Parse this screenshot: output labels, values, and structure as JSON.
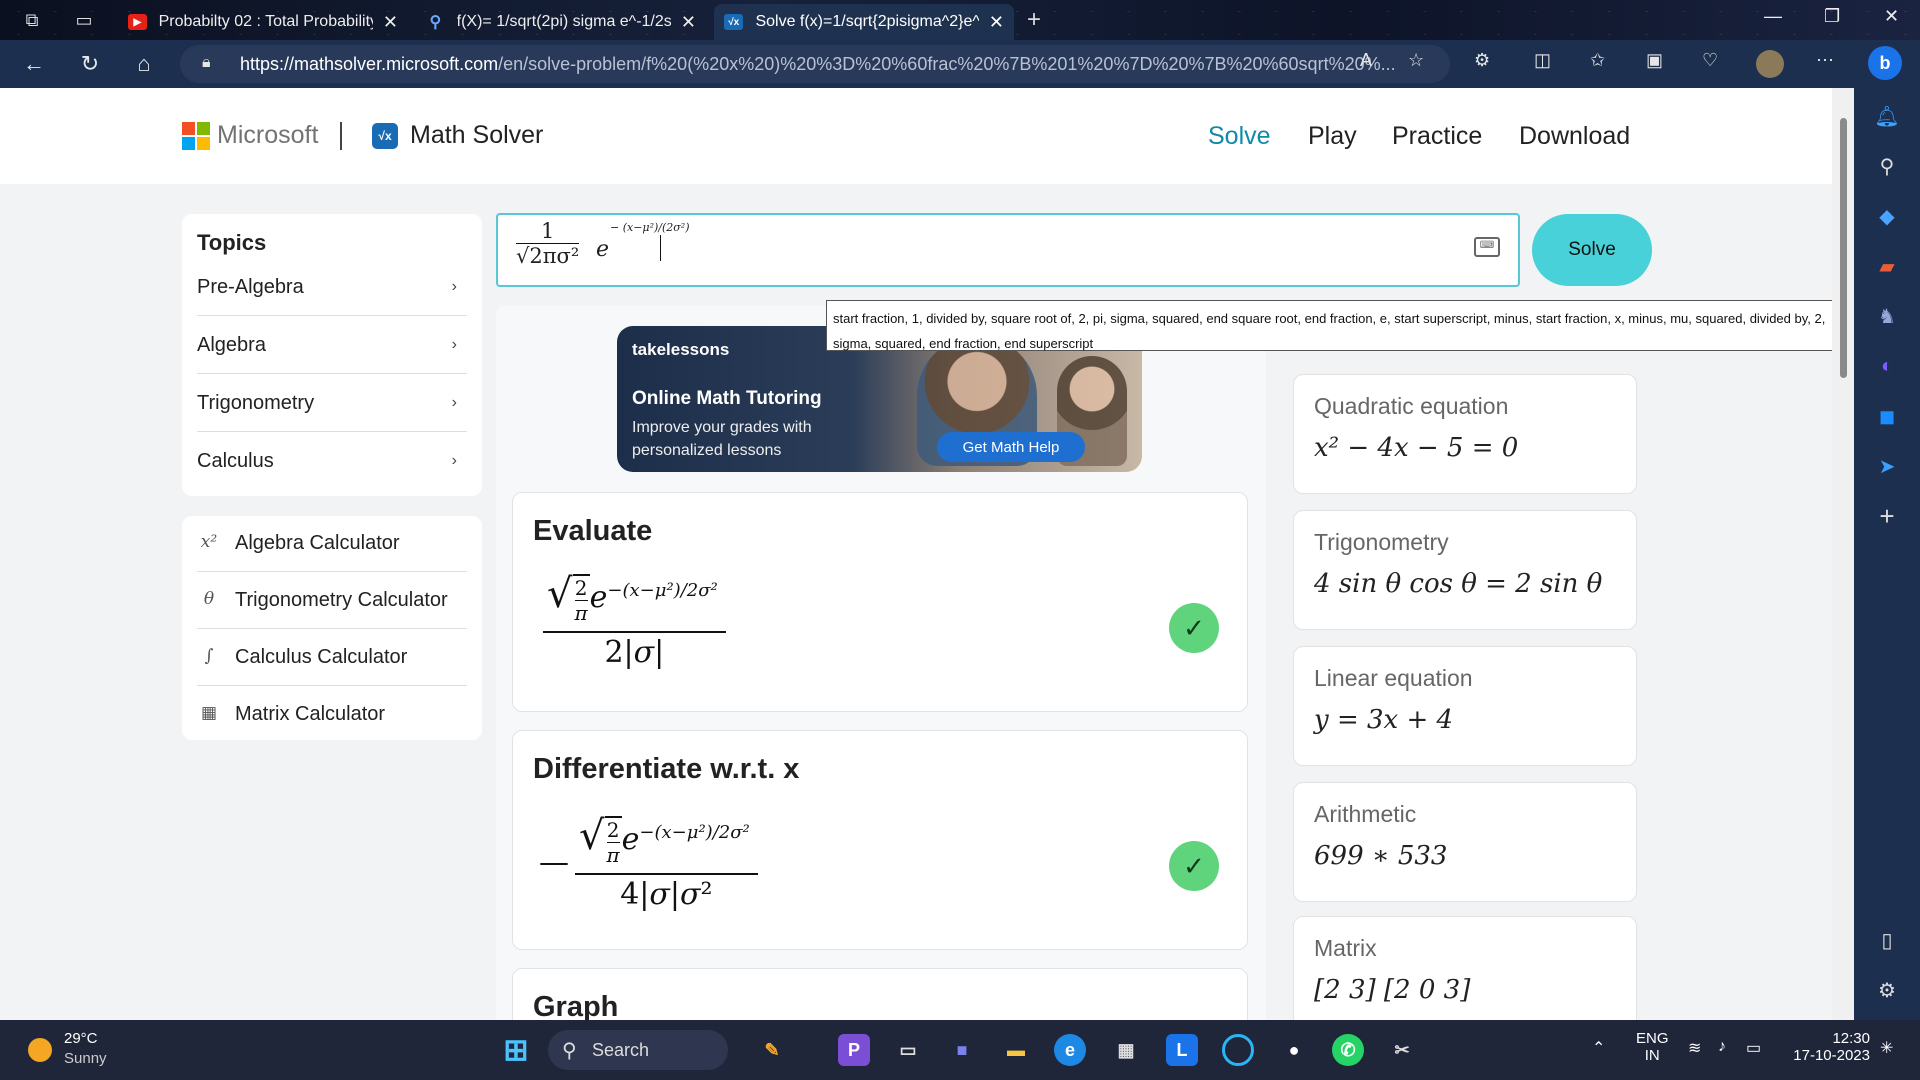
{
  "browser": {
    "tabs": [
      {
        "title": "Probabilty 02 : Total Probability",
        "favicon": "youtube-icon"
      },
      {
        "title": "f(X)= 1/sqrt(2pi) sigma e^-1/2sig",
        "favicon": "search-icon"
      },
      {
        "title": "Solve f(x)=1/sqrt{2pisigma^2}e^",
        "favicon": "math-solver-icon"
      }
    ],
    "url_host": "https://mathsolver.microsoft.com",
    "url_rest": "/en/solve-problem/f%20(%20x%20)%20%3D%20%60frac%20%7B%201%20%7D%20%7B%20%60sqrt%20%..."
  },
  "header": {
    "brand": "Microsoft",
    "product": "Math Solver",
    "nav": [
      "Solve",
      "Play",
      "Practice",
      "Download"
    ],
    "active_nav": "Solve"
  },
  "topics": {
    "title": "Topics",
    "items": [
      "Pre-Algebra",
      "Algebra",
      "Trigonometry",
      "Calculus"
    ]
  },
  "calculators": {
    "items": [
      {
        "icon": "x²",
        "label": "Algebra Calculator"
      },
      {
        "icon": "θ",
        "label": "Trigonometry Calculator"
      },
      {
        "icon": "∫",
        "label": "Calculus Calculator"
      },
      {
        "icon": "▦",
        "label": "Matrix Calculator"
      }
    ]
  },
  "input": {
    "numerator": "1",
    "denominator": "√2πσ²",
    "exponent": "− (x−μ²)/(2σ²)",
    "solve_label": "Solve"
  },
  "tooltip": "start fraction, 1, divided by, square root of, 2, pi, sigma, squared, end square root, end fraction, e, start superscript, minus, start fraction, x, minus, mu, squared, divided by, 2, sigma, squared, end fraction, end superscript",
  "ad": {
    "brand": "takelessons",
    "headline": "Online Math Tutoring",
    "sub": "Improve your grades with personalized lessons",
    "cta": "Get Math Help"
  },
  "results": [
    {
      "title": "Evaluate"
    },
    {
      "title": "Differentiate w.r.t. x"
    },
    {
      "title": "Graph"
    }
  ],
  "examples": [
    {
      "label": "Quadratic equation",
      "eq": "x² − 4x − 5 = 0"
    },
    {
      "label": "Trigonometry",
      "eq": "4 sin θ cos θ = 2 sin θ"
    },
    {
      "label": "Linear equation",
      "eq": "y = 3x + 4"
    },
    {
      "label": "Arithmetic",
      "eq": "699 ∗ 533"
    },
    {
      "label": "Matrix",
      "eq": "[2 3] [2 0 3]"
    }
  ],
  "taskbar": {
    "temp": "29°C",
    "weather": "Sunny",
    "search": "Search",
    "lang1": "ENG",
    "lang2": "IN",
    "time": "12:30",
    "date": "17-10-2023"
  }
}
